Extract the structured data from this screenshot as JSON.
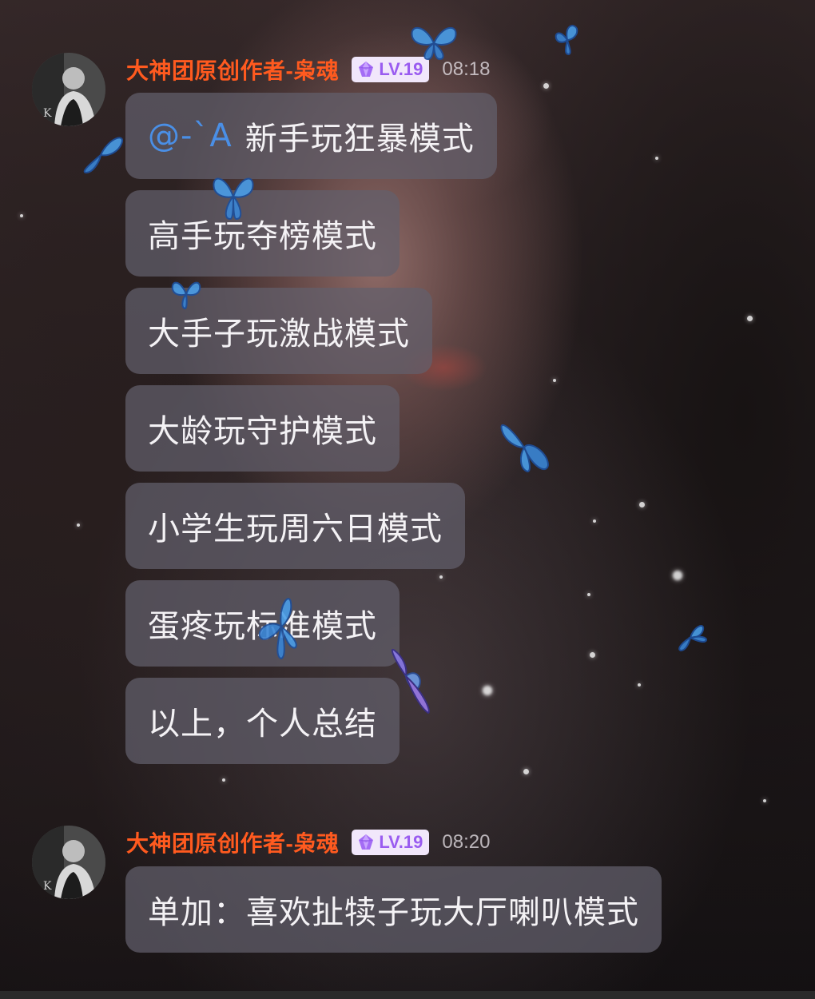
{
  "messages": [
    {
      "author": "大神团原创作者-枭魂",
      "level": "LV.19",
      "time": "08:18",
      "bubbles": [
        {
          "mention": "@-`A",
          "text": "新手玩狂暴模式"
        },
        {
          "text": "高手玩夺榜模式"
        },
        {
          "text": "大手子玩激战模式"
        },
        {
          "text": "大龄玩守护模式"
        },
        {
          "text": "小学生玩周六日模式"
        },
        {
          "text": "蛋疼玩标准模式"
        },
        {
          "text": "以上，个人总结"
        }
      ]
    },
    {
      "author": "大神团原创作者-枭魂",
      "level": "LV.19",
      "time": "08:20",
      "bubbles": [
        {
          "text": "单加：喜欢扯犊子玩大厅喇叭模式"
        }
      ]
    }
  ],
  "colors": {
    "username": "#ff5a1f",
    "level_text": "#9a5cf0",
    "level_badge_bg": "#f1e7fb",
    "mention": "#4a8fe6",
    "bubble_bg": "rgba(98,96,108,0.72)",
    "bubble_text": "#f4f2f5"
  },
  "icons": {
    "level_gem": "purple-gem-icon",
    "decoration": "butterfly-icon"
  }
}
